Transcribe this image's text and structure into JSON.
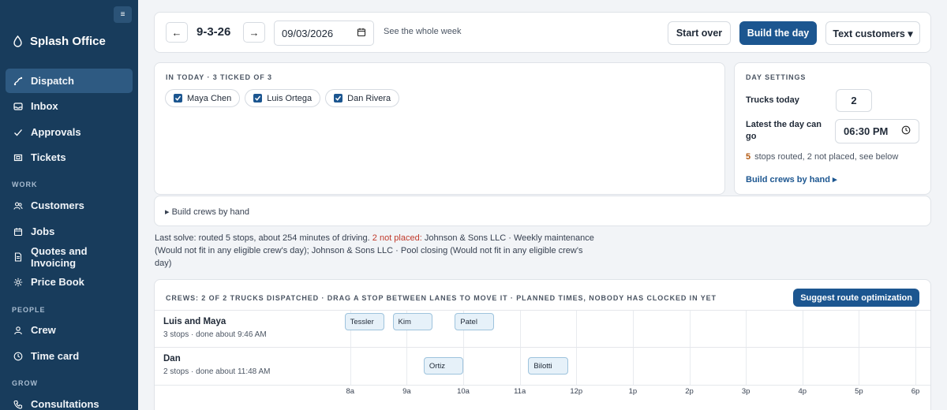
{
  "sidebar": {
    "brand": "Splash Office",
    "collapse_label": "≡",
    "items": [
      {
        "label": "Dispatch",
        "icon": "dispatch-icon",
        "active": true
      },
      {
        "label": "Inbox",
        "icon": "inbox-icon"
      },
      {
        "label": "Approvals",
        "icon": "check-icon"
      },
      {
        "label": "Tickets",
        "icon": "ticket-icon"
      }
    ],
    "sections": [
      {
        "title": "WORK",
        "items": [
          {
            "label": "Customers",
            "icon": "people-icon"
          },
          {
            "label": "Jobs",
            "icon": "calendar-icon"
          },
          {
            "label": "Quotes and Invoicing",
            "icon": "document-icon"
          },
          {
            "label": "Price Book",
            "icon": "gear-icon"
          }
        ]
      },
      {
        "title": "PEOPLE",
        "items": [
          {
            "label": "Crew",
            "icon": "person-icon"
          },
          {
            "label": "Time card",
            "icon": "clock-icon"
          }
        ]
      },
      {
        "title": "GROW",
        "items": [
          {
            "label": "Consultations",
            "icon": "phone-icon"
          }
        ]
      }
    ]
  },
  "topbar": {
    "prev": "←",
    "next": "→",
    "date_label": "9-3-26",
    "date_value": "09/03/2026",
    "see_week": "See the whole week",
    "start_over": "Start over",
    "build_day": "Build the day",
    "text_customers": "Text customers ▾"
  },
  "in_today": {
    "heading": "IN TODAY  · 3 TICKED OF 3",
    "people": [
      "Maya Chen",
      "Luis Ortega",
      "Dan Rivera"
    ]
  },
  "day_settings": {
    "heading": "DAY SETTINGS",
    "trucks_label": "Trucks today",
    "trucks_value": "2",
    "latest_label": "Latest the day can go",
    "latest_value": "06:30 PM",
    "summary_count": "5",
    "summary_text": "stops routed, 2 not placed, see below",
    "build_link": "Build crews by hand ▸"
  },
  "build_hand": {
    "label": "▸  Build crews by hand"
  },
  "last_solve": {
    "prefix": "Last solve: routed 5 stops, about 254 minutes of driving.",
    "warn": "2 not placed:",
    "detail": "Johnson & Sons LLC · Weekly maintenance (Would not fit in any eligible crew's day); Johnson & Sons LLC · Pool closing (Would not fit in any eligible crew's day)"
  },
  "crews": {
    "heading": "CREWS: 2 OF 2 TRUCKS DISPATCHED · DRAG A STOP BETWEEN LANES TO MOVE IT · PLANNED TIMES, NOBODY HAS CLOCKED IN YET",
    "suggest": "Suggest route optimization",
    "axis_start_hour": 7.5,
    "axis_end_hour": 18,
    "ticks": [
      {
        "label": "8a",
        "hour": 8
      },
      {
        "label": "9a",
        "hour": 9
      },
      {
        "label": "10a",
        "hour": 10
      },
      {
        "label": "11a",
        "hour": 11
      },
      {
        "label": "12p",
        "hour": 12
      },
      {
        "label": "1p",
        "hour": 13
      },
      {
        "label": "2p",
        "hour": 14
      },
      {
        "label": "3p",
        "hour": 15
      },
      {
        "label": "4p",
        "hour": 16
      },
      {
        "label": "5p",
        "hour": 17
      },
      {
        "label": "6p",
        "hour": 18
      }
    ],
    "lanes": [
      {
        "name": "Luis and Maya",
        "sub": "3 stops · done about 9:46 AM",
        "stops": [
          {
            "label": "Tessler",
            "start": 7.9,
            "end": 8.6
          },
          {
            "label": "Kim",
            "start": 8.75,
            "end": 9.45
          },
          {
            "label": "Patel",
            "start": 9.85,
            "end": 10.55
          }
        ]
      },
      {
        "name": "Dan",
        "sub": "2 stops · done about 11:48 AM",
        "stops": [
          {
            "label": "Ortiz",
            "start": 9.3,
            "end": 10.0
          },
          {
            "label": "Bilotti",
            "start": 11.15,
            "end": 11.85
          }
        ]
      }
    ]
  }
}
